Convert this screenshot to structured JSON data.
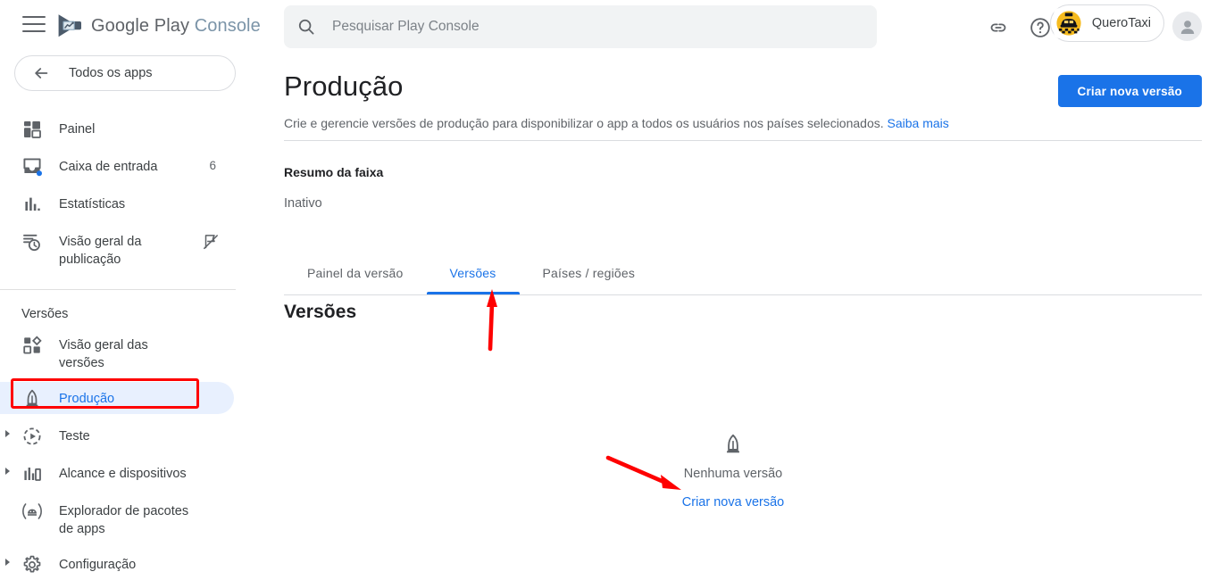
{
  "colors": {
    "accent": "#1a73e8",
    "pill_bg": "#e8f0fe",
    "annotation": "#fe0000",
    "text_primary": "#202124",
    "text_secondary": "#5f6368",
    "search_bg": "#f1f3f4",
    "taxi_yellow": "#f6bb1e"
  },
  "topbar": {
    "menu_icon": "hamburger-menu-icon",
    "logo_icon": "google-play-console-logo",
    "brand_google_play": "Google Play",
    "brand_console": "Console",
    "search": {
      "icon": "search-icon",
      "value": "",
      "placeholder": "Pesquisar Play Console"
    },
    "link_icon": "link-icon",
    "help_icon": "help-circle-icon",
    "app_chip": {
      "icon": "taxi-app-icon",
      "name": "QueroTaxi"
    },
    "avatar": "user-avatar-icon"
  },
  "sidebar": {
    "all_apps": {
      "icon": "arrow-back-icon",
      "label": "Todos os apps"
    },
    "items": [
      {
        "icon": "dashboard-icon",
        "label": "Painel",
        "badge": "",
        "caret": false,
        "trailing": ""
      },
      {
        "icon": "inbox-icon",
        "label": "Caixa de entrada",
        "badge": "6",
        "caret": false,
        "trailing": ""
      },
      {
        "icon": "statistics-bars-icon",
        "label": "Estatísticas",
        "badge": "",
        "caret": false,
        "trailing": ""
      },
      {
        "icon": "publishing-clock-icon",
        "label": "Visão geral da publicação",
        "badge": "",
        "caret": false,
        "trailing": "publish-off-icon"
      }
    ],
    "section_label": "Versões",
    "release_items": [
      {
        "icon": "releases-overview-icon",
        "label": "Visão geral das versões",
        "caret": false,
        "active": false
      },
      {
        "icon": "rocket-icon",
        "label": "Produção",
        "caret": false,
        "active": true
      },
      {
        "icon": "test-play-icon",
        "label": "Teste",
        "caret": true,
        "active": false
      },
      {
        "icon": "reach-devices-icon",
        "label": "Alcance e dispositivos",
        "caret": true,
        "active": false
      },
      {
        "icon": "android-package-icon",
        "label": "Explorador de pacotes de apps",
        "caret": false,
        "active": false
      },
      {
        "icon": "gear-icon",
        "label": "Configuração",
        "caret": true,
        "active": false
      }
    ]
  },
  "main": {
    "title": "Produção",
    "subtitle": "Crie e gerencie versões de produção para disponibilizar o app a todos os usuários nos países selecionados.",
    "subtitle_link": "Saiba mais",
    "create_button": "Criar nova versão",
    "summary_heading": "Resumo da faixa",
    "summary_value": "Inativo",
    "tabs": [
      {
        "label": "Painel da versão",
        "selected": false
      },
      {
        "label": "Versões",
        "selected": true
      },
      {
        "label": "Países / regiões",
        "selected": false
      }
    ],
    "section_title": "Versões",
    "empty_state": {
      "icon": "rocket-icon",
      "text": "Nenhuma versão",
      "link": "Criar nova versão"
    }
  },
  "annotations": [
    {
      "name": "arrow-pointing-to-versoes-tab",
      "type": "arrow-up",
      "color": "#fe0000"
    },
    {
      "name": "arrow-pointing-to-criar-nova-versao-link",
      "type": "arrow-diagonal",
      "color": "#fe0000"
    },
    {
      "name": "highlight-box-producao-sidebar",
      "type": "rectangle",
      "color": "#fe0000"
    }
  ]
}
